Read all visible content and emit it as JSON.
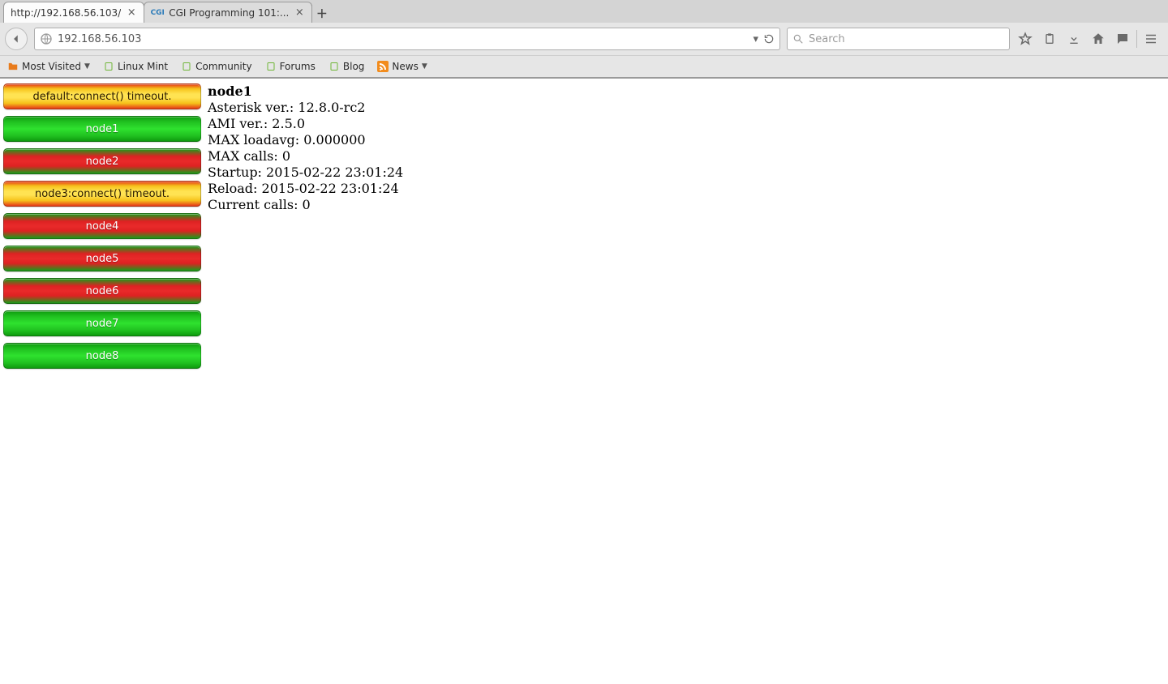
{
  "tabs": [
    {
      "label": "http://192.168.56.103/",
      "active": true
    },
    {
      "label": "CGI Programming 101:...",
      "active": false
    }
  ],
  "url": "192.168.56.103",
  "search": {
    "placeholder": "Search"
  },
  "bookmarks": {
    "most_visited": "Most Visited",
    "linux_mint": "Linux Mint",
    "community": "Community",
    "forums": "Forums",
    "blog": "Blog",
    "news": "News"
  },
  "nodes": [
    {
      "label": "default:connect() timeout.",
      "style": "timeout"
    },
    {
      "label": "node1",
      "style": "green"
    },
    {
      "label": "node2",
      "style": "red"
    },
    {
      "label": "node3:connect() timeout.",
      "style": "timeout"
    },
    {
      "label": "node4",
      "style": "red"
    },
    {
      "label": "node5",
      "style": "red"
    },
    {
      "label": "node6",
      "style": "red"
    },
    {
      "label": "node7",
      "style": "green"
    },
    {
      "label": "node8",
      "style": "green"
    }
  ],
  "info": {
    "title": "node1",
    "asterisk": "Asterisk ver.: 12.8.0-rc2",
    "ami": "AMI ver.: 2.5.0",
    "loadavg": "MAX loadavg: 0.000000",
    "maxcalls": "MAX calls: 0",
    "startup": "Startup: 2015-02-22 23:01:24",
    "reload": "Reload: 2015-02-22 23:01:24",
    "current": "Current calls: 0"
  }
}
